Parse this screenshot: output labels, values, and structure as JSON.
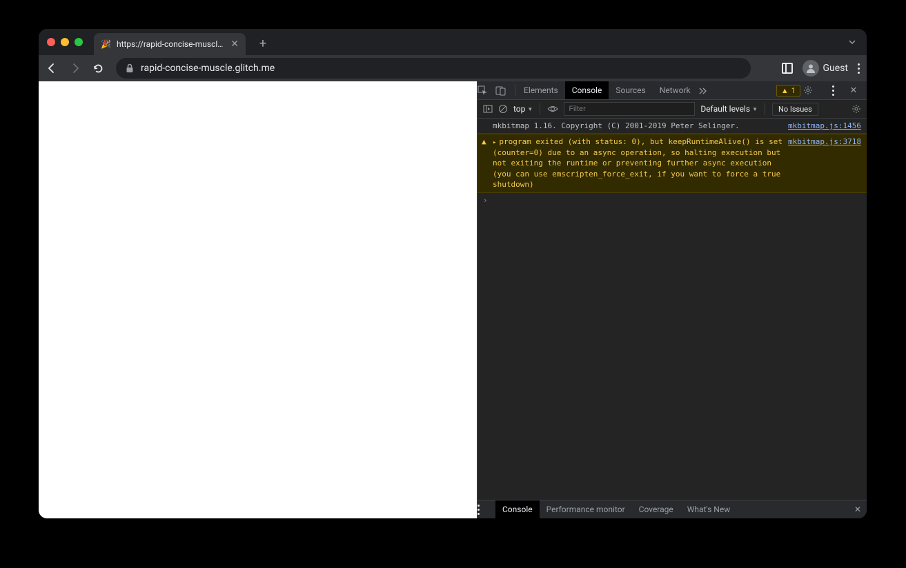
{
  "tab": {
    "favicon": "🎉",
    "title": "https://rapid-concise-muscle.g"
  },
  "address": {
    "url": "rapid-concise-muscle.glitch.me"
  },
  "guest": {
    "label": "Guest"
  },
  "devtools": {
    "tabs": {
      "elements": "Elements",
      "console": "Console",
      "sources": "Sources",
      "network": "Network"
    },
    "warn_count": "1",
    "controls": {
      "context": "top",
      "filter_placeholder": "Filter",
      "levels": "Default levels",
      "issues": "No Issues"
    },
    "log1": {
      "msg": "mkbitmap 1.16. Copyright (C) 2001-2019 Peter Selinger.",
      "src": "mkbitmap.js:1456"
    },
    "log2": {
      "msg": "program exited (with status: 0), but keepRuntimeAlive() is set (counter=0) due to an async operation, so halting execution but not exiting the runtime or preventing further async execution (you can use emscripten_force_exit, if you want to force a true shutdown)",
      "src": "mkbitmap.js:3718"
    },
    "drawer": {
      "console": "Console",
      "perf": "Performance monitor",
      "coverage": "Coverage",
      "whatsnew": "What's New"
    }
  }
}
